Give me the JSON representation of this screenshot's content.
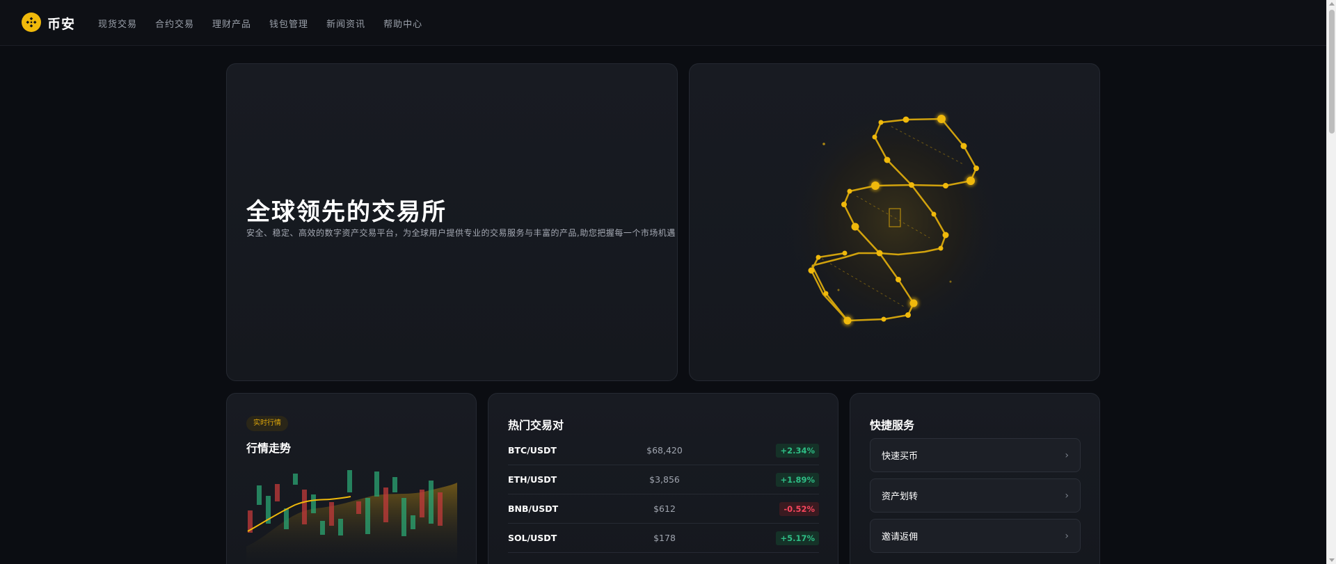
{
  "header": {
    "brand": "币安",
    "nav": [
      "现货交易",
      "合约交易",
      "理财产品",
      "钱包管理",
      "新闻资讯",
      "帮助中心"
    ]
  },
  "hero": {
    "title": "全球领先的交易所",
    "subtitle": "安全、稳定、高效的数字资产交易平台，为全球用户提供专业的交易服务与丰富的产品,助您把握每一个市场机遇"
  },
  "kline": {
    "badge": "实时行情",
    "title": "行情走势"
  },
  "market": {
    "title": "热门交易对",
    "rows": [
      {
        "pair": "BTC/USDT",
        "price": "$68,420",
        "change": "+2.34%",
        "direction": "up"
      },
      {
        "pair": "ETH/USDT",
        "price": "$3,856",
        "change": "+1.89%",
        "direction": "up"
      },
      {
        "pair": "BNB/USDT",
        "price": "$612",
        "change": "-0.52%",
        "direction": "down"
      },
      {
        "pair": "SOL/USDT",
        "price": "$178",
        "change": "+5.17%",
        "direction": "up"
      }
    ]
  },
  "services": {
    "title": "快捷服务",
    "items": [
      "快速买币",
      "资产划转",
      "邀请返佣"
    ]
  },
  "colors": {
    "accent": "#f0b90b",
    "up": "#2ebd85",
    "down": "#f6465d",
    "background": "#0b0d12"
  },
  "icons": {
    "logo": "binance-logo-icon",
    "chevron": "chevron-right-icon"
  }
}
